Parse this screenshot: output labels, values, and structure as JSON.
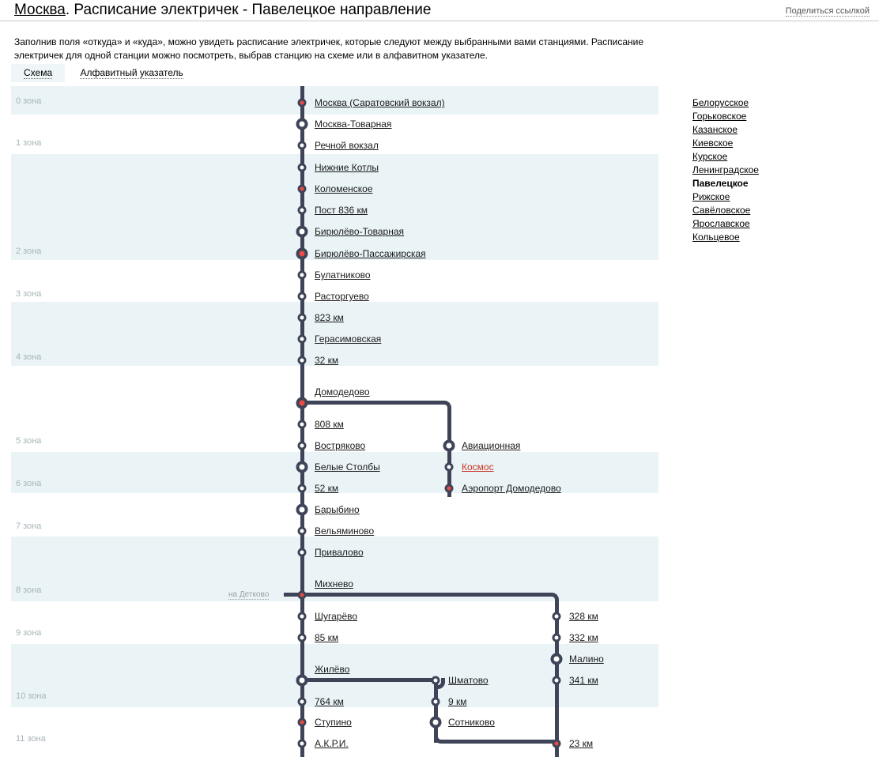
{
  "header": {
    "city": "Москва",
    "title_rest": ". Расписание электричек - Павелецкое направление",
    "share_label": "Поделиться ссылкой"
  },
  "intro": {
    "text": "Заполнив поля «откуда» и «куда», можно увидеть расписание электричек, которые следуют между выбранными вами станциями. Расписание электричек для одной станции можно посмотреть, выбрав станцию на схеме или в алфавитном указателе."
  },
  "tabs": [
    {
      "label": "Схема",
      "active": true
    },
    {
      "label": "Алфавитный указатель",
      "active": false
    }
  ],
  "zones": [
    {
      "label": "0 зона"
    },
    {
      "label": "1 зона"
    },
    {
      "label": "2 зона"
    },
    {
      "label": "3 зона"
    },
    {
      "label": "4 зона"
    },
    {
      "label": "5 зона"
    },
    {
      "label": "6 зона"
    },
    {
      "label": "7 зона"
    },
    {
      "label": "8 зона"
    },
    {
      "label": "9 зона"
    },
    {
      "label": "10 зона"
    },
    {
      "label": "11 зона"
    }
  ],
  "stations": {
    "main": [
      "Москва (Саратовский вокзал)",
      "Москва-Товарная",
      "Речной вокзал",
      "Нижние Котлы",
      "Коломенское",
      "Пост 836 км",
      "Бирюлёво-Товарная",
      "Бирюлёво-Пассажирская",
      "Булатниково",
      "Расторгуево",
      "823 км",
      "Герасимовская",
      "32 км",
      "Домодедово",
      "808 км",
      "Востряково",
      "Белые Столбы",
      "52 км",
      "Барыбино",
      "Вельяминово",
      "Привалово",
      "Михнево",
      "Шугарёво",
      "85 км",
      "Жилёво",
      "764 км",
      "Ступино",
      "А.К.Р.И."
    ],
    "airport_branch": [
      "Авиационная",
      "Космос",
      "Аэропорт Домодедово"
    ],
    "right_branch": [
      "328 км",
      "332 км",
      "Малино",
      "341 км",
      "23 км"
    ],
    "shmatovo_branch": [
      "Шматово",
      "9 км",
      "Сотниково"
    ],
    "detkovo_label": "на Детково"
  },
  "directions": [
    {
      "label": "Белорусское",
      "current": false
    },
    {
      "label": "Горьковское",
      "current": false
    },
    {
      "label": "Казанское",
      "current": false
    },
    {
      "label": "Киевское",
      "current": false
    },
    {
      "label": "Курское",
      "current": false
    },
    {
      "label": "Ленинградское",
      "current": false
    },
    {
      "label": "Павелецкое",
      "current": true
    },
    {
      "label": "Рижское",
      "current": false
    },
    {
      "label": "Савёловское",
      "current": false
    },
    {
      "label": "Ярославское",
      "current": false
    },
    {
      "label": "Кольцевое",
      "current": false
    }
  ],
  "colors": {
    "rail": "#3f4458",
    "station_red": "#ef4b45",
    "zone_band": "#eaf4f7",
    "red_link": "#cc3322"
  }
}
